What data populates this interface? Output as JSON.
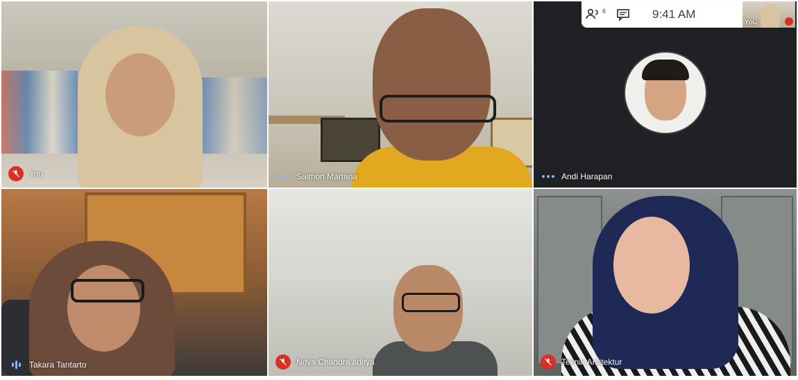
{
  "participants": [
    {
      "name": "You",
      "status": "muted"
    },
    {
      "name": "Salmon Martana",
      "status": "active"
    },
    {
      "name": "Andi Harapan",
      "status": "active"
    },
    {
      "name": "Takara Tantarto",
      "status": "speaking"
    },
    {
      "name": "Nova Chandra aditya",
      "status": "muted"
    },
    {
      "name": "Teknik Arsitektur",
      "status": "muted"
    }
  ],
  "topbar": {
    "people_count": "6",
    "time": "9:41 AM",
    "self_label": "You"
  },
  "icons": {
    "people": "people-icon",
    "chat": "chat-icon",
    "mic_off": "mic-off-icon",
    "speaking": "speaking-indicator-icon",
    "more": "more-dots-icon"
  },
  "colors": {
    "muted_red": "#d93025",
    "indicator_blue": "#8ab4f8",
    "tile_dark": "#202124"
  }
}
